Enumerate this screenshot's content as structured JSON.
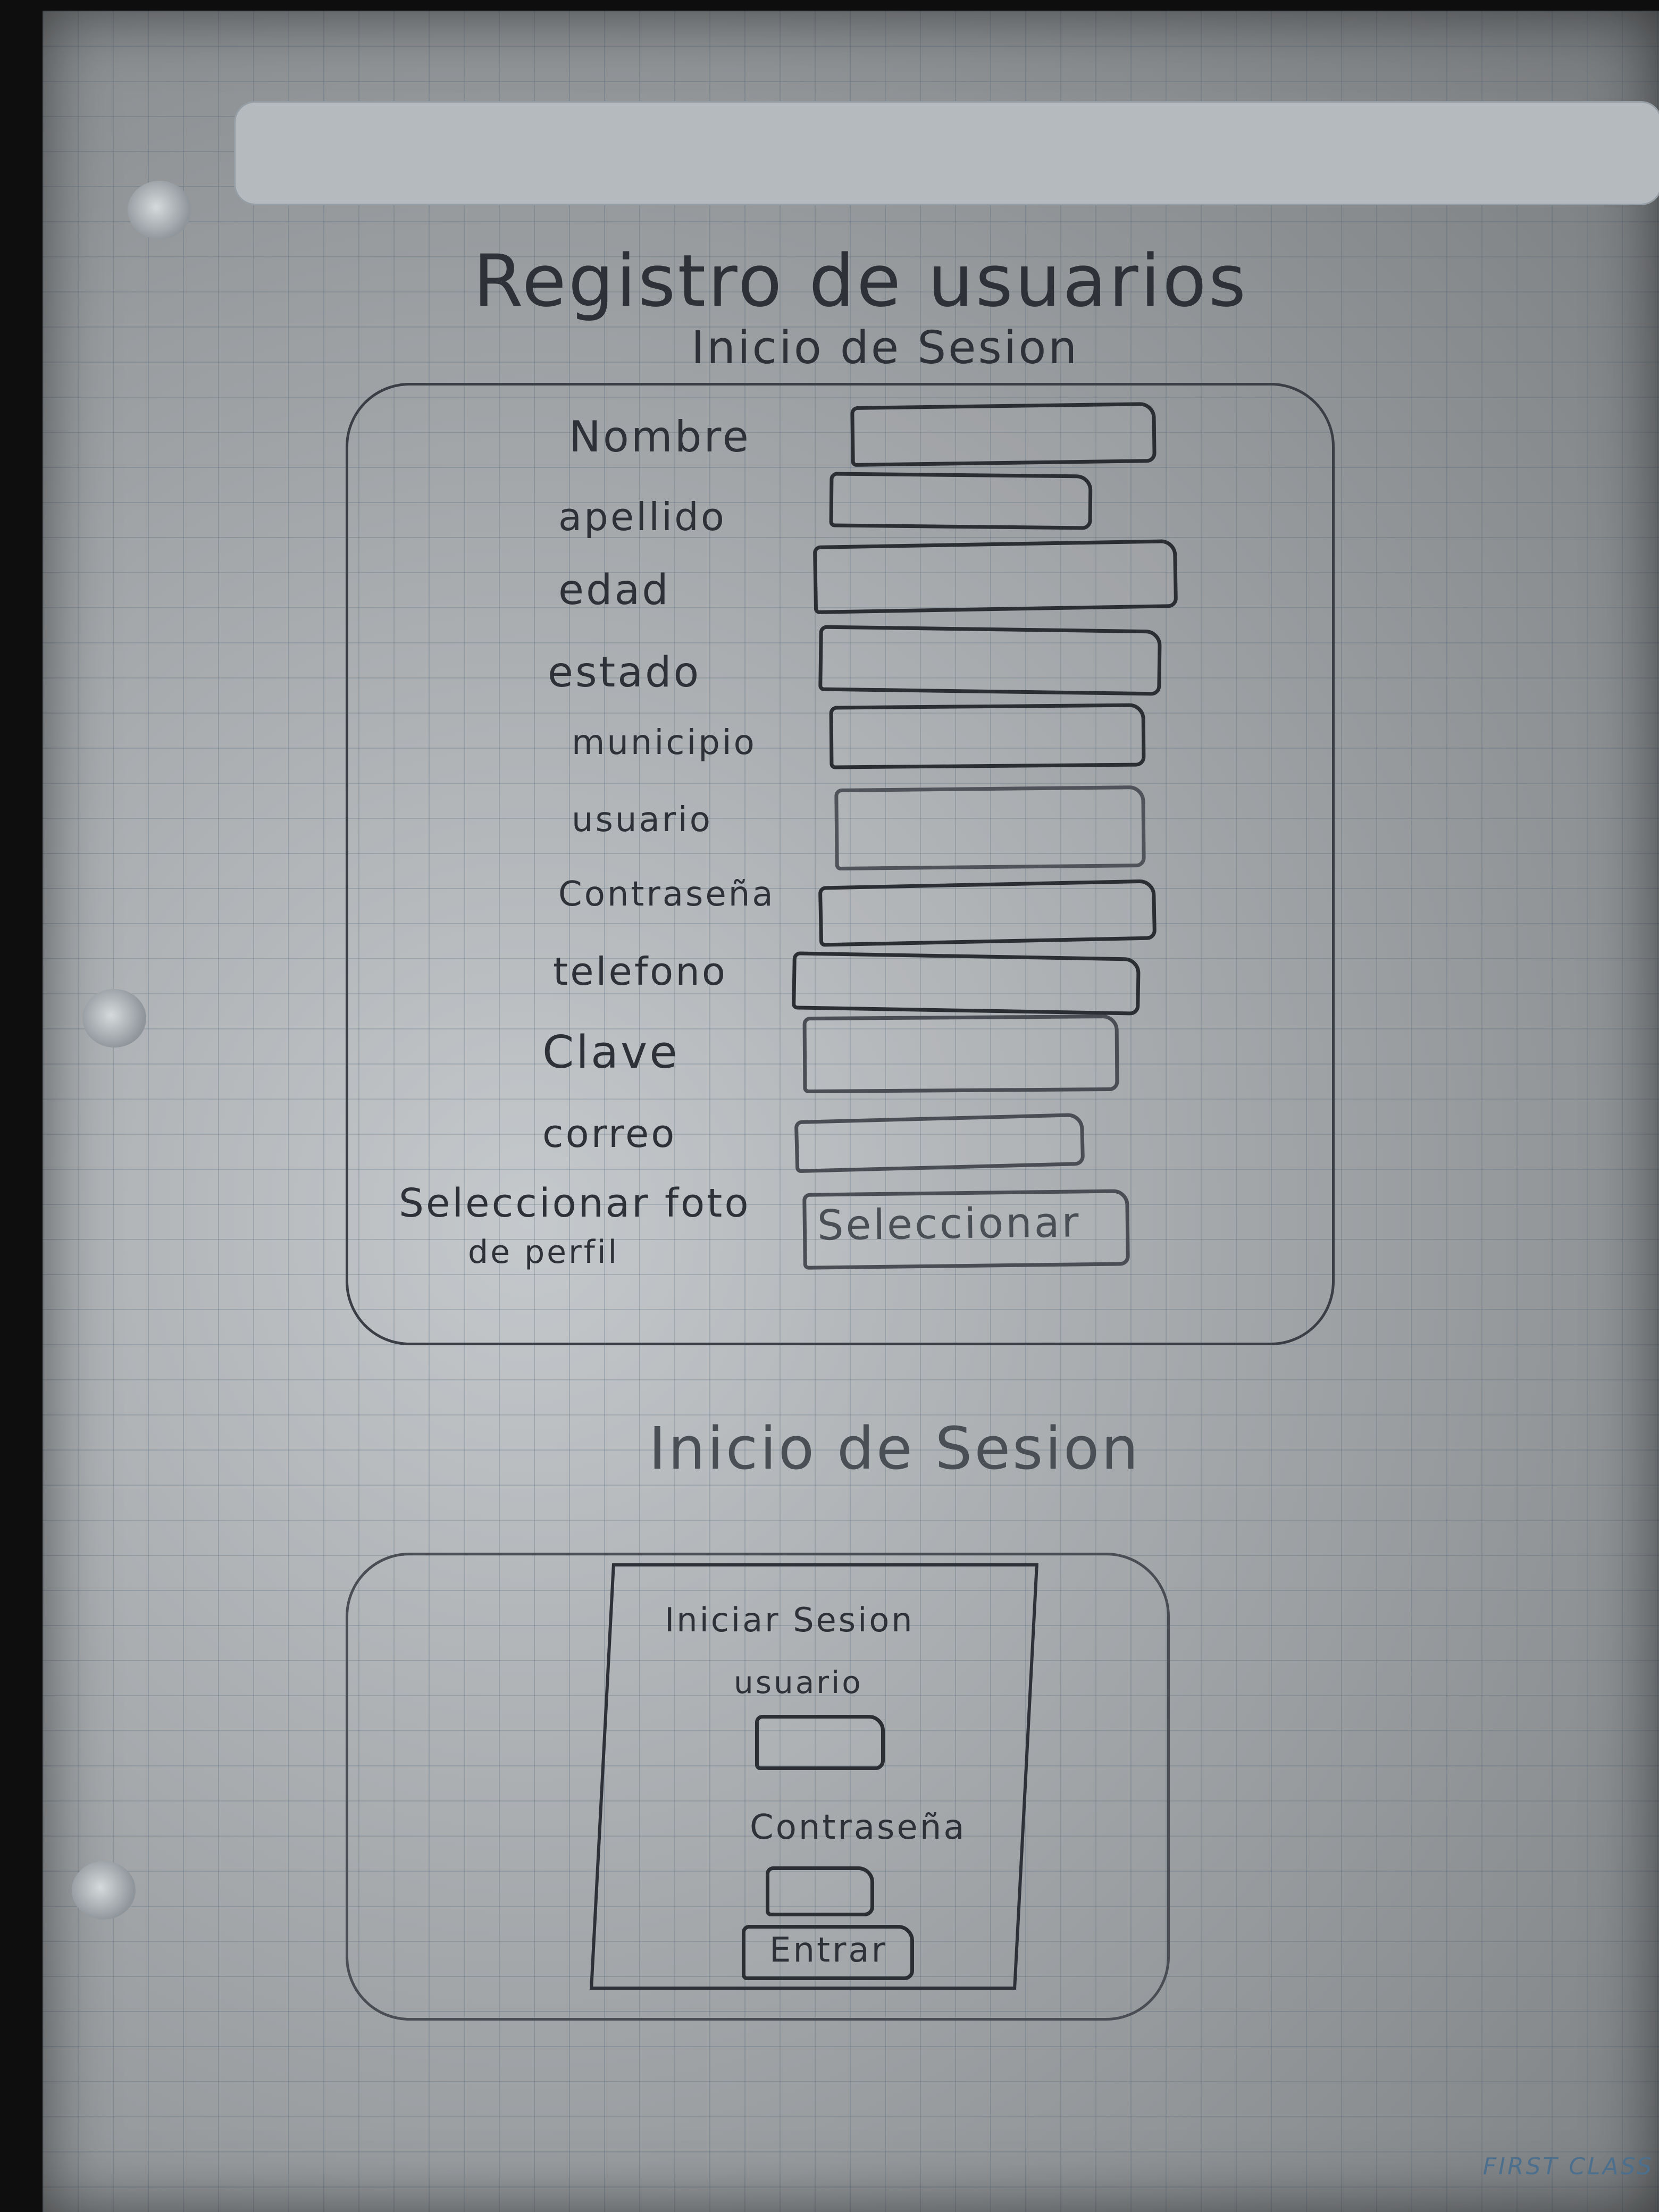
{
  "titles": {
    "main": "Registro de usuarios",
    "sub": "Inicio de Sesion",
    "section2": "Inicio de Sesion"
  },
  "register_form": {
    "labels": [
      "Nombre",
      "apellido",
      "edad",
      "estado",
      "municipio",
      "usuario",
      "Contraseña",
      "telefono",
      "Clave",
      "correo"
    ],
    "photo_label_line1": "Seleccionar foto",
    "photo_label_line2": "de perfil",
    "photo_button": "Seleccionar"
  },
  "login_form": {
    "title": "Iniciar Sesion",
    "user_label": "usuario",
    "password_label": "Contraseña",
    "submit": "Entrar"
  },
  "footer_brand": "FIRST CLASS"
}
